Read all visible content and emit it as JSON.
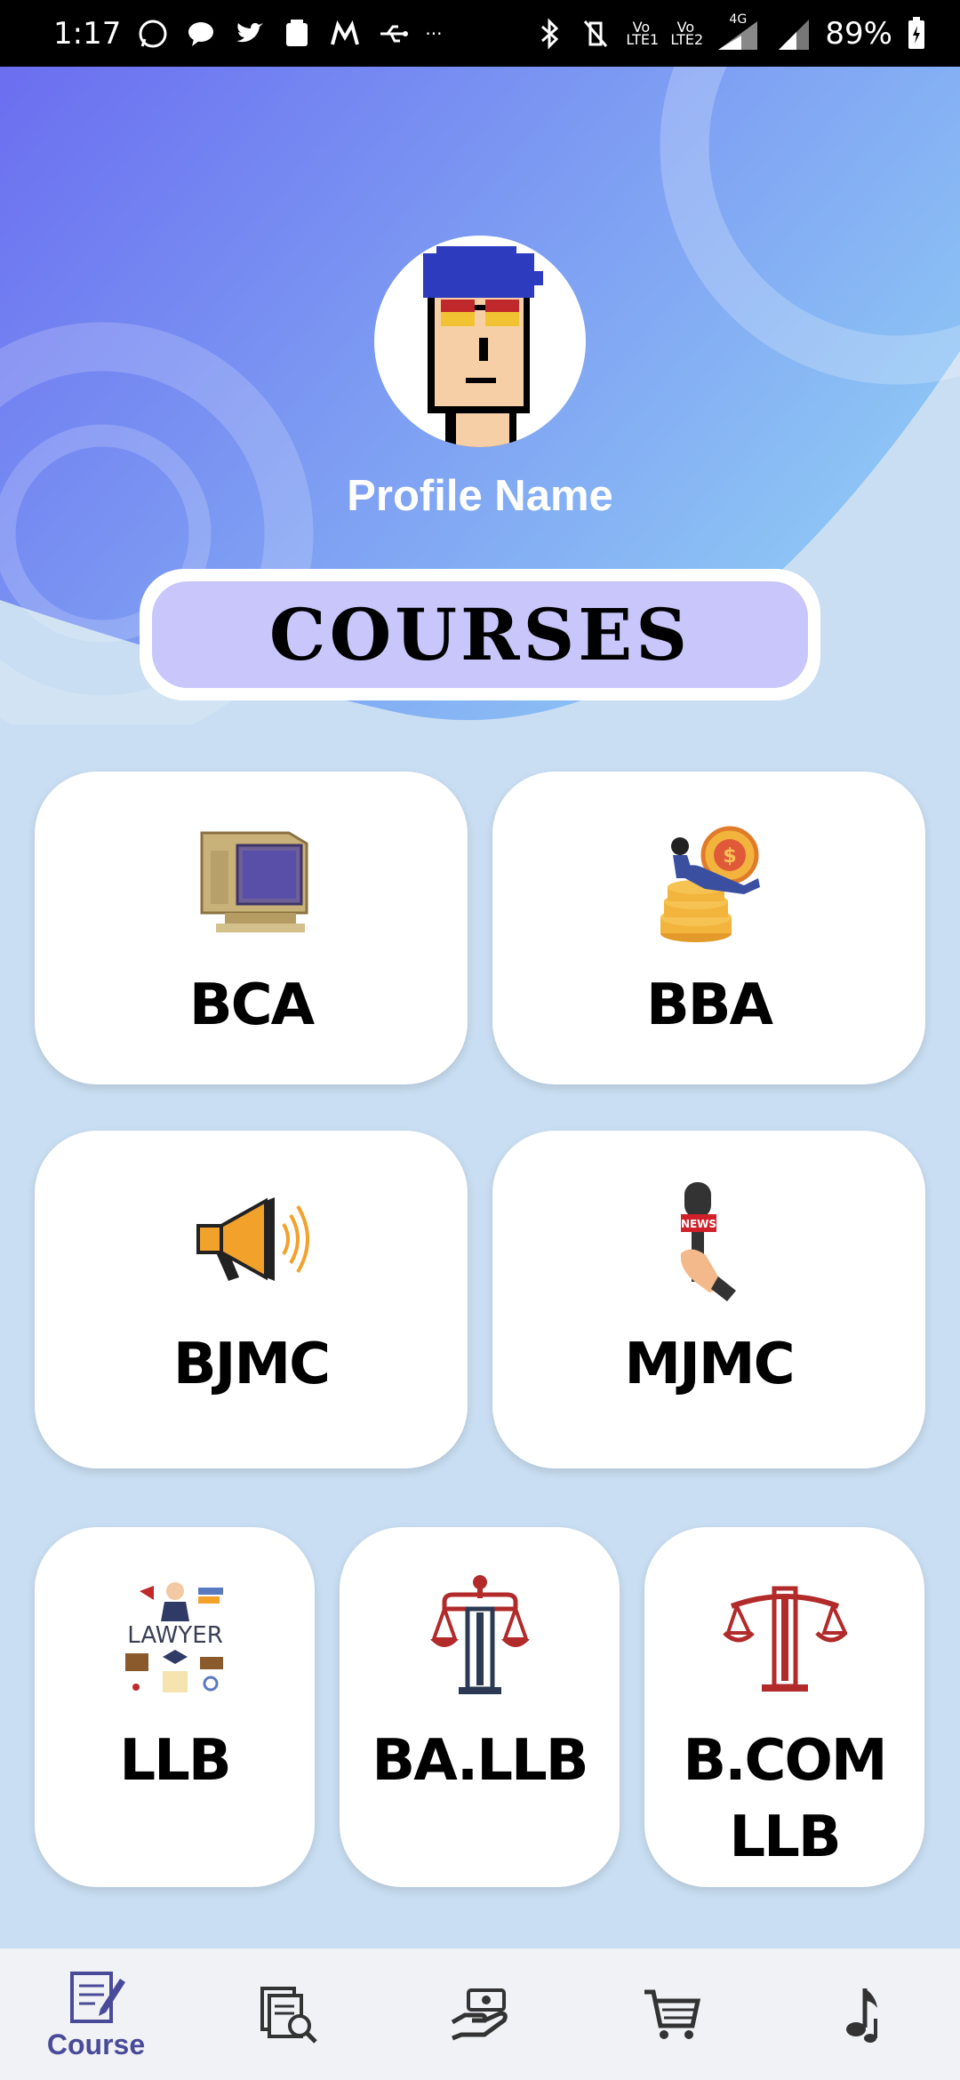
{
  "status": {
    "time": "1:17",
    "battery": "89%",
    "net_4g": "4G",
    "volte1": "Vo LTE1",
    "volte2": "Vo LTE2",
    "more": "···"
  },
  "profile": {
    "name": "Profile Name"
  },
  "section": {
    "title": "COURSES"
  },
  "courses": [
    {
      "label": "BCA",
      "icon": "retro-computer-icon"
    },
    {
      "label": "BBA",
      "icon": "coin-stack-icon"
    },
    {
      "label": "BJMC",
      "icon": "megaphone-icon"
    },
    {
      "label": "MJMC",
      "icon": "news-microphone-icon"
    },
    {
      "label": "LLB",
      "icon": "lawyer-icon"
    },
    {
      "label": "BA.LLB",
      "icon": "justice-pillar-icon"
    },
    {
      "label": "B.COM",
      "label2": "LLB",
      "icon": "scales-icon"
    }
  ],
  "bottom_nav": {
    "course_label": "Course"
  },
  "colors": {
    "header_start": "#6b6ef0",
    "header_end": "#8ec8f5",
    "background": "#c9def2",
    "pill": "#c9c6fb",
    "accent": "#4a4a9a"
  }
}
